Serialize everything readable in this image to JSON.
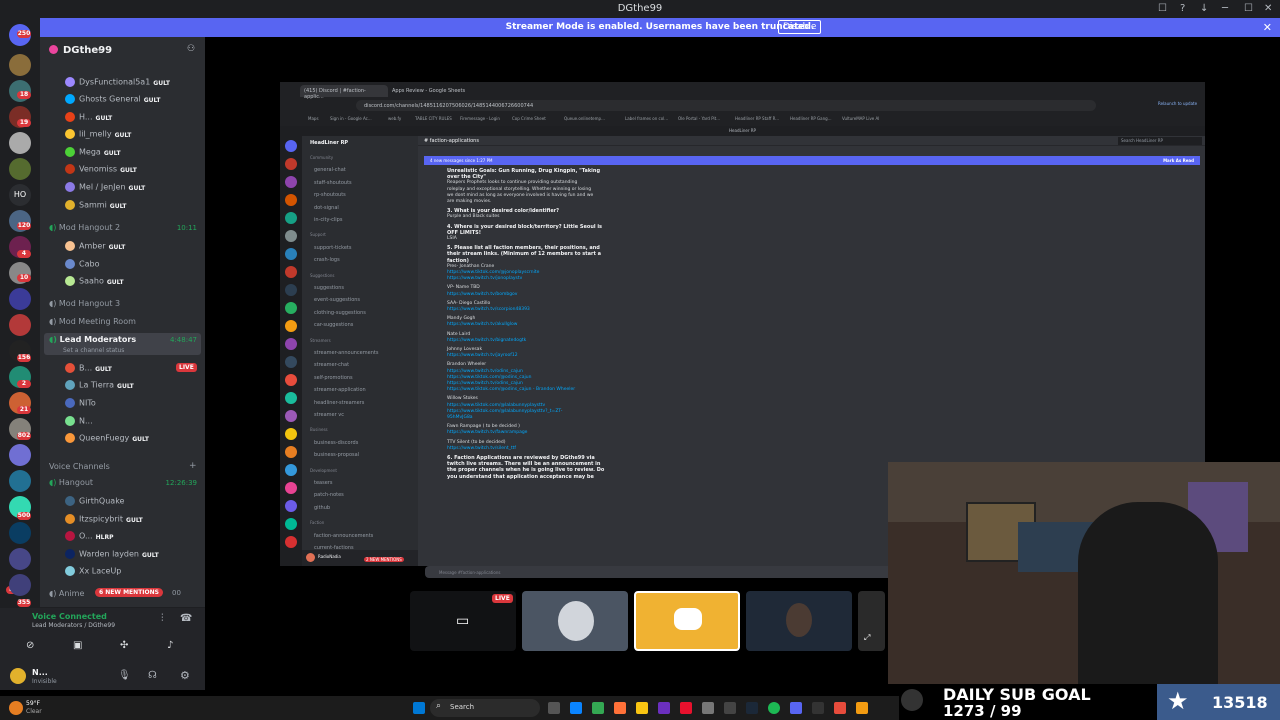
{
  "window": {
    "title": "DGthe99",
    "controls": [
      "☐",
      "?",
      "↓",
      "─",
      "☐",
      "✕"
    ]
  },
  "banner": {
    "message": "Streamer Mode is enabled. Usernames have been truncated.",
    "button": "Disable",
    "close": "✕"
  },
  "rail": {
    "badges": [
      "250",
      "18",
      "19",
      "120",
      "4",
      "10",
      "156",
      "2",
      "21",
      "802",
      "500",
      "NEW",
      "355"
    ],
    "home_text": "HO"
  },
  "sidebar": {
    "server_name": "DGthe99",
    "members_top": [
      {
        "name": "DysFunctional5a1",
        "tag": "GULT"
      },
      {
        "name": "Ghosts General",
        "tag": "GULT"
      },
      {
        "name": "H...",
        "tag": "GULT"
      },
      {
        "name": "lil_melly",
        "tag": "GULT"
      },
      {
        "name": "Mega",
        "tag": "GULT"
      },
      {
        "name": "Venomiss",
        "tag": "GULT"
      },
      {
        "name": "Mel / JenJen",
        "tag": "GULT"
      },
      {
        "name": "Sammi",
        "tag": "GULT"
      }
    ],
    "channel_hangout2": {
      "name": "Mod Hangout 2",
      "time": "10:11"
    },
    "members_hangout2": [
      {
        "name": "Amber",
        "tag": "GULT"
      },
      {
        "name": "Cabo",
        "tag": ""
      },
      {
        "name": "Saaho",
        "tag": "GULT"
      }
    ],
    "channel_hangout3": "Mod Hangout 3",
    "channel_meeting": "Mod Meeting Room",
    "channel_lead": {
      "name": "Lead Moderators",
      "status": "Set a channel status",
      "time": "4:48:47"
    },
    "members_lead": [
      {
        "name": "B...",
        "tag": "GULT",
        "live": "LIVE"
      },
      {
        "name": "La Tierra",
        "tag": "GULT"
      },
      {
        "name": "NITo",
        "tag": ""
      },
      {
        "name": "N...",
        "tag": ""
      },
      {
        "name": "QueenFuegy",
        "tag": "GULT"
      }
    ],
    "voice_category": "Voice Channels",
    "channel_hangout": {
      "name": "Hangout",
      "time": "12:26:39"
    },
    "members_hangout": [
      {
        "name": "GirthQuake",
        "tag": ""
      },
      {
        "name": "Itzspicybrit",
        "tag": "GULT"
      },
      {
        "name": "O...",
        "tag": "HLRP"
      },
      {
        "name": "Warden layden",
        "tag": "GULT"
      },
      {
        "name": "Xx LaceUp",
        "tag": ""
      }
    ],
    "channel_anime": {
      "name": "Anime",
      "mentions": "6 NEW MENTIONS",
      "count": "00"
    }
  },
  "voice": {
    "status": "Voice Connected",
    "channel": "Lead Moderators / DGthe99"
  },
  "user": {
    "name": "N...",
    "status": "Invisible"
  },
  "browser": {
    "tabs": [
      "(415) Discord | #faction-applic...",
      "Apps Review - Google Sheets"
    ],
    "url": "discord.com/channels/1485116207506026/1485144006726600744",
    "bookmarks": [
      "Maps",
      "Sign in - Google Ac...",
      "web.fy",
      "TABLE CITY RULES",
      "Firemessage - Login",
      "Cop Crime Sheet",
      "Queue.onlinetemp...",
      "Label frames on col...",
      "Ole Portal - Yard Pit...",
      "Headliner RP Staff R...",
      "Headliner RP Gang...",
      "VultureMAP Live Al"
    ],
    "update_btn": "Relaunch to update",
    "inner_title": "HeadLiner RP",
    "inner_server": "HeadLiner RP",
    "channel_header": "faction-applications",
    "search": "Search HeadLiner RP",
    "new_messages": "4 new messages since 1:27 PM",
    "mark_read": "Mark As Read",
    "channels": [
      {
        "cat": "Community"
      },
      {
        "name": "general-chat"
      },
      {
        "name": "staff-shoutouts"
      },
      {
        "name": "rp-shoutouts"
      },
      {
        "name": "dot-signal"
      },
      {
        "name": "in-city-clips"
      },
      {
        "cat": "Support"
      },
      {
        "name": "support-tickets"
      },
      {
        "name": "crash-logs"
      },
      {
        "cat": "Suggestions"
      },
      {
        "name": "suggestions"
      },
      {
        "name": "event-suggestions"
      },
      {
        "name": "clothing-suggestions"
      },
      {
        "name": "car-suggestions"
      },
      {
        "cat": "Streamers"
      },
      {
        "name": "streamer-announcements"
      },
      {
        "name": "streamer-chat"
      },
      {
        "name": "self-promotions"
      },
      {
        "name": "streamer-application"
      },
      {
        "name": "headliner-streamers"
      },
      {
        "name": "streamer vc"
      },
      {
        "cat": "Business"
      },
      {
        "name": "business-discords"
      },
      {
        "name": "business-proposal"
      },
      {
        "cat": "Development"
      },
      {
        "name": "teasers"
      },
      {
        "name": "patch-notes"
      },
      {
        "name": "github"
      },
      {
        "cat": "Faction"
      },
      {
        "name": "faction-announcements"
      },
      {
        "name": "current-factions"
      },
      {
        "name": "..."
      }
    ],
    "message_lines": [
      {
        "t": "Unrealistic Goals: Gun Running, Drug Kingpin, \"Taking",
        "s": "b"
      },
      {
        "t": "over the City\"",
        "s": "b"
      },
      {
        "t": "Reapers Prophets looks to continue providing outstanding",
        "s": ""
      },
      {
        "t": "roleplay and exceptional storytelling. Whether winning or losing",
        "s": ""
      },
      {
        "t": "we dont mind as long as everyone involved is having fun and we",
        "s": ""
      },
      {
        "t": "are making movies.",
        "s": ""
      },
      {
        "t": "3. What is your desired color/identifier?",
        "s": "b"
      },
      {
        "t": "Purple and Black suites",
        "s": ""
      },
      {
        "t": "4. Where is your desired block/territory? Little Seoul is",
        "s": "b"
      },
      {
        "t": "OFF LIMITS!",
        "s": "b"
      },
      {
        "t": "LSIA",
        "s": ""
      },
      {
        "t": "5. Please list all faction members, their positions, and",
        "s": "b"
      },
      {
        "t": "their stream links. (Minimum of 12 members to start a",
        "s": "b"
      },
      {
        "t": "faction)",
        "s": "b"
      },
      {
        "t": "Pres- Jonathan Crane",
        "s": ""
      },
      {
        "t": "https://www.tiktok.com/@jonoplayscrnite",
        "s": "l"
      },
      {
        "t": "https://www.twitch.tv/jonoplaystv",
        "s": "l"
      },
      {
        "t": "VP- Name TBD",
        "s": ""
      },
      {
        "t": "https://www.twitch.tv/bombgov",
        "s": "l"
      },
      {
        "t": "SAA- Diego Castillo",
        "s": ""
      },
      {
        "t": "https://www.twitch.tv/scorpion48393",
        "s": "l"
      },
      {
        "t": "Mandy Gogh",
        "s": ""
      },
      {
        "t": "https://www.twitch.tv/akullglow",
        "s": "l"
      },
      {
        "t": "Nate Laird",
        "s": ""
      },
      {
        "t": "https://www.twitch.tv/bignatedogtk",
        "s": "l"
      },
      {
        "t": "Johnny Lovesak",
        "s": ""
      },
      {
        "t": "https://www.twitch.tv/jayroof12",
        "s": "l"
      },
      {
        "t": "Brandon Wheeler",
        "s": ""
      },
      {
        "t": "https://www.twitch.tv/odins_cajun",
        "s": "l"
      },
      {
        "t": "https://www.tiktok.com/@odins_cajun",
        "s": "l"
      },
      {
        "t": "https://www.twitch.tv/odins_cajun",
        "s": "l"
      },
      {
        "t": "https://www.tiktok.com/@odins_cajun - Brandon Wheeler",
        "s": "l"
      },
      {
        "t": "Willow Stokes",
        "s": ""
      },
      {
        "t": "https://www.tiktok.com/@lalabunnyplaysttv",
        "s": "l"
      },
      {
        "t": "https://www.tiktok.com/@lalabunnyplaysttv?_t=ZT-",
        "s": "l"
      },
      {
        "t": "95hMvJG8a",
        "s": "l"
      },
      {
        "t": "Fawn Rampage ( to be decided )",
        "s": ""
      },
      {
        "t": "https://www.twitch.tv/fawnrampage",
        "s": "l"
      },
      {
        "t": "TTV Silent (to be decided)",
        "s": ""
      },
      {
        "t": "https://www.twitch.tv/silent_ttf",
        "s": "l"
      },
      {
        "t": "6. Faction Applications are reviewed by DGthe99 via",
        "s": "b"
      },
      {
        "t": "twitch live streams. There will be an announcement in",
        "s": "b"
      },
      {
        "t": "the proper channels when he is going live to review. Do",
        "s": "b"
      },
      {
        "t": "you understand that application acceptance may be",
        "s": "b"
      }
    ],
    "inner_user": "RadioNadia",
    "inner_mentions": "2 NEW MENTIONS",
    "composer_placeholder": "Message #faction-applications",
    "inner_badges": {
      "suggestions": "23 New",
      "clothing": "11 New",
      "car": "14 New"
    }
  },
  "stream_thumbs": {
    "live": "LIVE"
  },
  "subgoal": {
    "label": "DAILY SUB GOAL",
    "progress": "1273 / 99",
    "count": "13518"
  },
  "taskbar": {
    "search": "Search",
    "weather": "59°F",
    "weather_sub": "Clear"
  },
  "colors": {
    "blurple": "#5865f2",
    "green": "#23a55a",
    "red": "#da373c",
    "link": "#00a8fc"
  }
}
